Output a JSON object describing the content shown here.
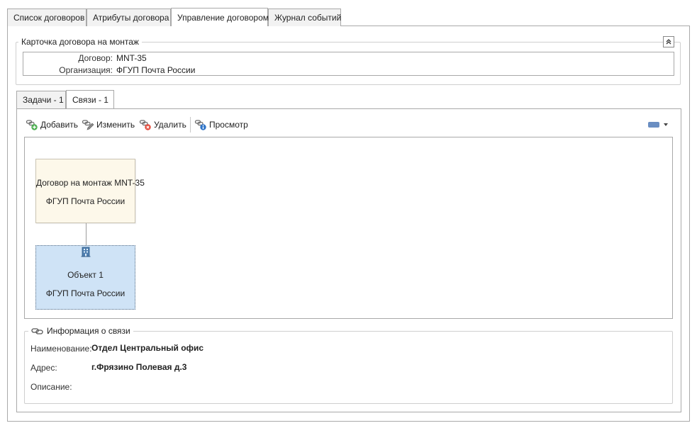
{
  "top_tabs": [
    "Список договоров",
    "Атрибуты договора",
    "Управление договором",
    "Журнал событий"
  ],
  "card": {
    "title": "Карточка договора на монтаж",
    "contract_label": "Договор:",
    "contract_value": "MNT-35",
    "org_label": "Организация:",
    "org_value": "ФГУП Почта России"
  },
  "inner_tabs": [
    "Задачи - 1",
    "Связи - 1"
  ],
  "toolbar": {
    "add": "Добавить",
    "edit": "Изменить",
    "delete": "Удалить",
    "view": "Просмотр"
  },
  "diagram": {
    "parent": {
      "title": "Договор на монтаж MNT-35",
      "subtitle": "ФГУП Почта России"
    },
    "child": {
      "title": "Объект 1",
      "subtitle": "ФГУП Почта России"
    }
  },
  "info": {
    "title": "Информация о связи",
    "name_label": "Наименование:",
    "name_value": "Отдел Центральный офис",
    "address_label": "Адрес:",
    "address_value": "г.Фрязино Полевая д.3",
    "description_label": "Описание:",
    "description_value": ""
  },
  "colors": {
    "parent_node_bg": "#fdf8ea",
    "child_node_bg": "#cfe3f6",
    "child_node_border": "#5a6f86",
    "swatch": "#6a8ec2"
  },
  "icons": {
    "add": "link-add-icon",
    "edit": "link-edit-icon",
    "delete": "link-delete-icon",
    "view": "link-view-icon",
    "collapse": "chevron-double-up-icon",
    "building": "building-icon",
    "info": "link-icon"
  }
}
